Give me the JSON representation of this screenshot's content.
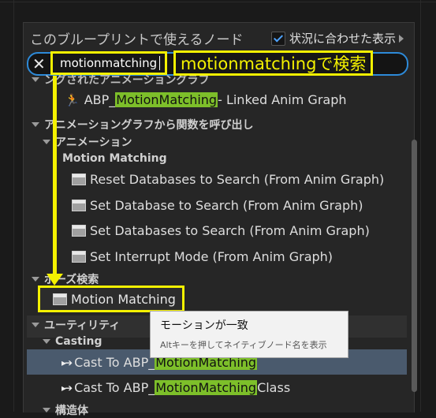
{
  "panel": {
    "title": "このブループリントで使えるノード",
    "context_sensitive_label": "状況に合わせた表示",
    "context_sensitive_checked": true
  },
  "search": {
    "value": "motionmatching"
  },
  "annotation": {
    "text": "motionmatchingで検索"
  },
  "tree": {
    "partial_top": "ングされたアニメーショングラフ",
    "linked_item": {
      "prefix": "ABP_",
      "match": "MotionMatching",
      "suffix": " - Linked Anim Graph"
    },
    "anim_funcs_cat": "アニメーショングラフから関数を呼び出し",
    "animation_cat": "アニメーション",
    "mm_cat": "Motion Matching",
    "items": [
      "Reset Databases to Search (From Anim Graph)",
      "Set Database to Search (From Anim Graph)",
      "Set Databases to Search (From Anim Graph)",
      "Set Interrupt Mode (From Anim Graph)"
    ],
    "pose_search_cat": "ポーズ検索",
    "motion_matching_node": "Motion Matching",
    "utility_cat": "ユーティリティ",
    "casting_cat": "Casting",
    "cast1": {
      "prefix": "Cast To ABP_",
      "match": "MotionMatching",
      "suffix": ""
    },
    "cast2": {
      "prefix": "Cast To ABP_",
      "match": "MotionMatching",
      "suffix": " Class"
    },
    "struct_cat": "構造体"
  },
  "tooltip": {
    "main": "モーションが一致",
    "sub": "Altキーを押してネイティブノード名を表示"
  },
  "colors": {
    "highlight": "#7dbf2a",
    "annotation_yellow": "#f4f100",
    "search_border": "#2d8ad8",
    "selection": "#4a5a6d"
  }
}
